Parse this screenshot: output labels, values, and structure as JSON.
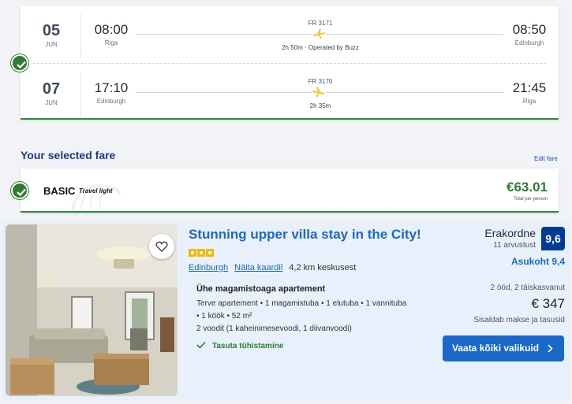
{
  "flights": {
    "outbound": {
      "day": "05",
      "month": "JUN",
      "dep_time": "08:00",
      "dep_city": "Riga",
      "arr_time": "08:50",
      "arr_city": "Edinburgh",
      "flight_no": "FR 3171",
      "duration": "2h 50m · Operated by Buzz"
    },
    "return": {
      "day": "07",
      "month": "JUN",
      "dep_time": "17:10",
      "dep_city": "Edinburgh",
      "arr_time": "21:45",
      "arr_city": "Riga",
      "flight_no": "FR 3170",
      "duration": "2h 35m"
    }
  },
  "fare": {
    "heading": "Your selected fare",
    "edit_label": "Edit fare",
    "name": "BASIC",
    "subtitle": "Travel light",
    "price": "€63.01",
    "price_note": "Total per person"
  },
  "hotel": {
    "title": "Stunning upper villa stay in the City!",
    "stars": 3,
    "city_link": "Edinburgh",
    "map_link": "Näita kaardil",
    "distance": "4,2 km keskusest",
    "room_type": "Ühe magamistoaga apartement",
    "room_desc_1": "Terve apartement • 1 magamistuba • 1 elutuba • 1 vannituba",
    "room_desc_2": "• 1 köök • 52 m²",
    "room_desc_3": "2 voodit (1 kaheinimesevoodi, 1 diivanvoodi)",
    "free_cancel": "Tasuta tühistamine",
    "review_word": "Erakordne",
    "review_count": "11 arvustust",
    "score": "9,6",
    "location_score": "Asukoht 9,4",
    "nights": "2 ööd, 2 täiskasvanut",
    "price": "€ 347",
    "tax_note": "Sisaldab makse ja tasusid",
    "button_label": "Vaata kõiki valikuid"
  },
  "colors": {
    "success_green": "#2e7d32",
    "brand_blue": "#1a68c8",
    "score_blue": "#003b95",
    "heading_navy": "#1b3a86",
    "plane_yellow": "#f1c933"
  }
}
